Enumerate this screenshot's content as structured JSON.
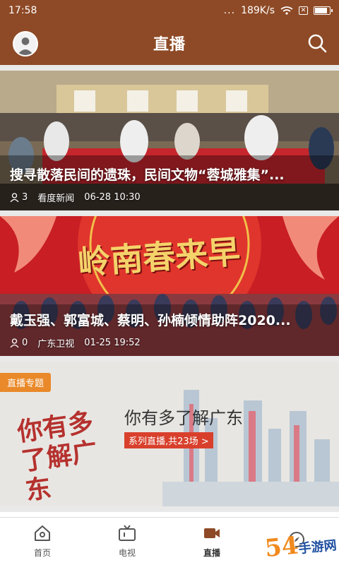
{
  "status_bar": {
    "time": "17:58",
    "dots": "...",
    "speed": "189K/s"
  },
  "header": {
    "title": "直播"
  },
  "feed": {
    "cards": [
      {
        "title": "搜寻散落民间的遗珠，民间文物“蓉城雅集”...",
        "viewers": "3",
        "source": "看度新闻",
        "time": "06-28 10:30"
      },
      {
        "title": "戴玉强、郭富城、蔡明、孙楠倾情助阵2020...",
        "viewers": "0",
        "source": "广东卫视",
        "time": "01-25 19:52",
        "poster_text": "岭南春来早"
      },
      {
        "badge": "直播专题",
        "title": "你有多了解广东",
        "subtitle": "系列直播,共23场 >",
        "poster_text": "你有多了解广东"
      }
    ]
  },
  "tabbar": {
    "tabs": [
      {
        "label": "首页",
        "icon": "home-icon"
      },
      {
        "label": "电视",
        "icon": "tv-icon"
      },
      {
        "label": "直播",
        "icon": "live-camera-icon"
      },
      {
        "label": "",
        "icon": "compass-icon"
      }
    ]
  },
  "colors": {
    "brand": "#8e4a26",
    "badge": "#e9892a",
    "accent": "#d8402c"
  }
}
